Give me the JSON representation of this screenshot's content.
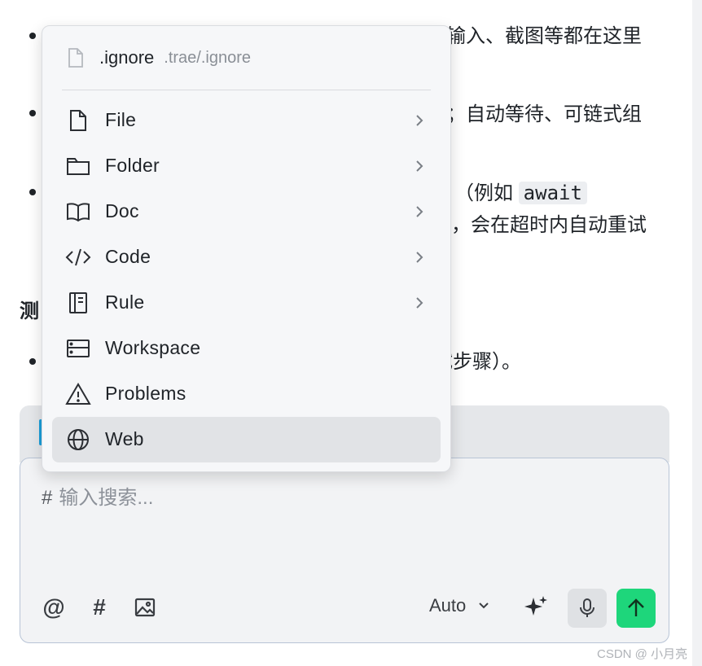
{
  "background_doc": {
    "line1_right": "输入、截图等都在这里",
    "line2_right": "；自动等待、可链式组",
    "line3_right_prefix": "（例如",
    "line3_code": "await",
    "line4_right": "，会在超时内自动重试",
    "heading_char": "测",
    "line5_right": "试步骤）。"
  },
  "menu": {
    "header": {
      "filename": ".ignore",
      "path": ".trae/.ignore",
      "icon": "file-outline-icon"
    },
    "items": [
      {
        "label": "File",
        "icon": "file-icon",
        "submenu": true
      },
      {
        "label": "Folder",
        "icon": "folder-icon",
        "submenu": true
      },
      {
        "label": "Doc",
        "icon": "book-icon",
        "submenu": true
      },
      {
        "label": "Code",
        "icon": "code-icon",
        "submenu": true
      },
      {
        "label": "Rule",
        "icon": "rule-icon",
        "submenu": true
      },
      {
        "label": "Workspace",
        "icon": "workspace-icon",
        "submenu": false
      },
      {
        "label": "Problems",
        "icon": "warning-icon",
        "submenu": false
      },
      {
        "label": "Web",
        "icon": "globe-icon",
        "submenu": false,
        "selected": true
      }
    ]
  },
  "input": {
    "prefix": "#",
    "placeholder": "输入搜索..."
  },
  "toolbar": {
    "mention_symbol": "@",
    "hash_symbol": "#",
    "model_select": "Auto"
  },
  "colors": {
    "send_button": "#1ed67b",
    "menu_bg": "#f6f7f9",
    "selected_item_bg": "#e1e3e6",
    "accent_bar": "#1a9fdc"
  },
  "watermark": "CSDN @  小月亮"
}
